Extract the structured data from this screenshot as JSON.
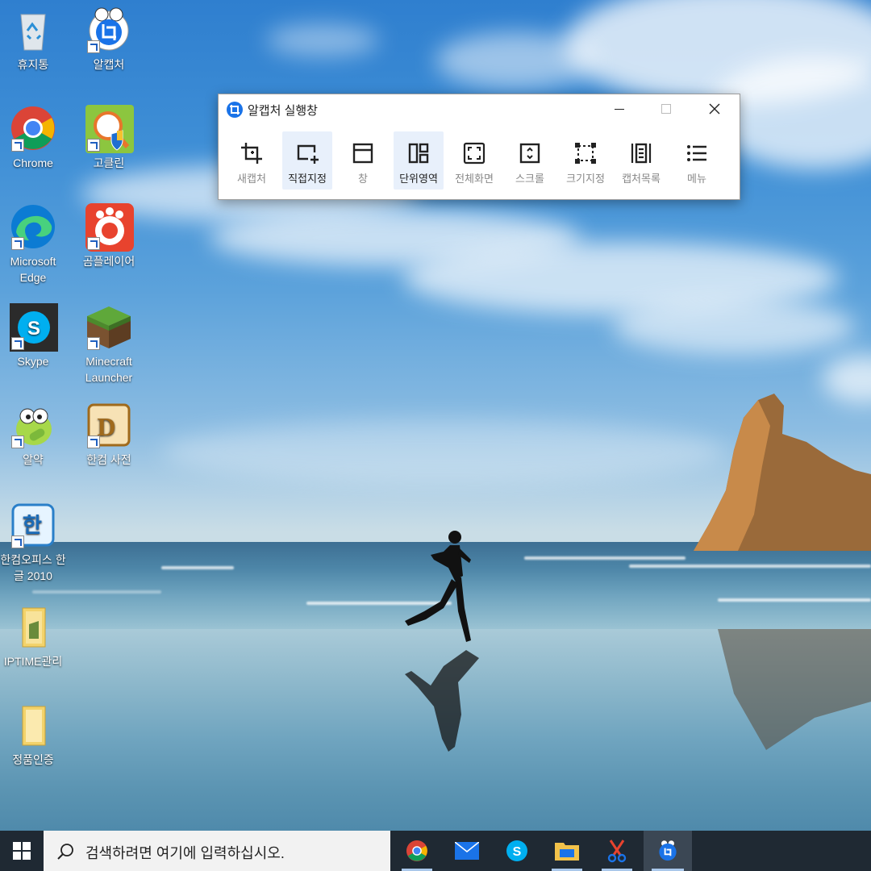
{
  "desktop": {
    "icons": [
      {
        "label": "휴지통",
        "icon": "recycle-bin-icon"
      },
      {
        "label": "알캡처",
        "icon": "alcapture-icon"
      },
      {
        "label": "Chrome",
        "icon": "chrome-icon"
      },
      {
        "label": "고클린",
        "icon": "goclean-icon"
      },
      {
        "label": "Microsoft Edge",
        "icon": "edge-icon"
      },
      {
        "label": "곰플레이어",
        "icon": "gomplayer-icon"
      },
      {
        "label": "Skype",
        "icon": "skype-icon"
      },
      {
        "label": "Minecraft Launcher",
        "icon": "minecraft-icon"
      },
      {
        "label": "알약",
        "icon": "alyac-icon"
      },
      {
        "label": "한컴 사전",
        "icon": "hancom-dictionary-icon"
      },
      {
        "label": "한컴오피스 한글 2010",
        "icon": "hangul-2010-icon"
      },
      {
        "label": "IPTIME관리",
        "icon": "folder-icon"
      },
      {
        "label": "정품인증",
        "icon": "folder-icon"
      }
    ]
  },
  "capture_window": {
    "title": "알캡처 실행창",
    "tools": [
      {
        "label": "새캡처",
        "icon": "crop-icon",
        "active": false
      },
      {
        "label": "직접지정",
        "icon": "select-region-icon",
        "active": true
      },
      {
        "label": "창",
        "icon": "window-icon",
        "active": false
      },
      {
        "label": "단위영역",
        "icon": "unit-region-icon",
        "active": true
      },
      {
        "label": "전체화면",
        "icon": "fullscreen-icon",
        "active": false
      },
      {
        "label": "스크롤",
        "icon": "scroll-icon",
        "active": false
      },
      {
        "label": "크기지정",
        "icon": "fixed-size-icon",
        "active": false
      },
      {
        "label": "캡처목록",
        "icon": "capture-list-icon",
        "active": false
      },
      {
        "label": "메뉴",
        "icon": "menu-icon",
        "active": false
      }
    ]
  },
  "taskbar": {
    "search_placeholder": "검색하려면 여기에 입력하십시오.",
    "apps": [
      {
        "name": "chrome-icon",
        "active": false,
        "running": true
      },
      {
        "name": "mail-icon",
        "active": false,
        "running": false
      },
      {
        "name": "skype-icon",
        "active": false,
        "running": false
      },
      {
        "name": "file-explorer-icon",
        "active": false,
        "running": true
      },
      {
        "name": "snipping-tool-icon",
        "active": false,
        "running": true
      },
      {
        "name": "alcapture-icon",
        "active": true,
        "running": true
      }
    ]
  },
  "colors": {
    "accent": "#1a73e8",
    "taskbar": "#1f2933",
    "tool_active_bg": "#e8f0fb"
  }
}
